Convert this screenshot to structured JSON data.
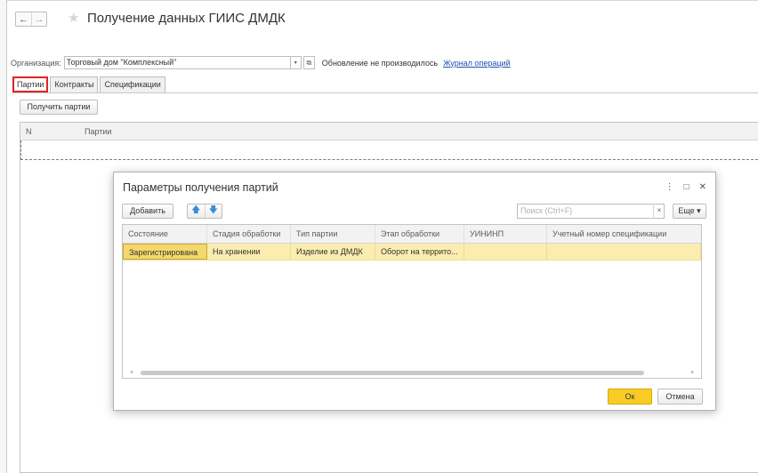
{
  "header": {
    "back_icon": "←",
    "forward_icon": "→",
    "star_icon": "★",
    "title": "Получение данных ГИИС ДМДК"
  },
  "org": {
    "label": "Организация:",
    "value": "Торговый дом \"Комплексный\"",
    "dropdown_icon": "▾",
    "open_icon": "⧉",
    "status": "Обновление не производилось",
    "journal_link": "Журнал операций"
  },
  "tabs": [
    {
      "label": "Партии",
      "active": true
    },
    {
      "label": "Контракты",
      "active": false
    },
    {
      "label": "Спецификации",
      "active": false
    }
  ],
  "main": {
    "get_button": "Получить партии",
    "columns": [
      "N",
      "Партии"
    ]
  },
  "dialog": {
    "title": "Параметры получения партий",
    "menu_icon": "⋮",
    "maximize_icon": "□",
    "close_icon": "✕",
    "add_button": "Добавить",
    "up_icon": "🡅",
    "down_icon": "🡇",
    "search_placeholder": "Поиск (Ctrl+F)",
    "search_clear_icon": "×",
    "more_button": "Еще ▾",
    "columns": [
      "Состояние",
      "Стадия обработки",
      "Тип партии",
      "Этап обработки",
      "УИНИНП",
      "Учетный номер спецификации"
    ],
    "rows": [
      {
        "state": "Зарегистрирована",
        "stage": "На хранении",
        "type": "Изделие из ДМДК",
        "phase": "Оборот на террито...",
        "uin": "",
        "spec": ""
      }
    ],
    "scroll_left_icon": "◂",
    "scroll_right_icon": "▸",
    "ok_button": "Ок",
    "cancel_button": "Отмена"
  },
  "colors": {
    "accent": "#f8cc24",
    "selection_row": "#fbedb0",
    "link": "#1a52b2",
    "active_tab_border": "#e32222"
  }
}
